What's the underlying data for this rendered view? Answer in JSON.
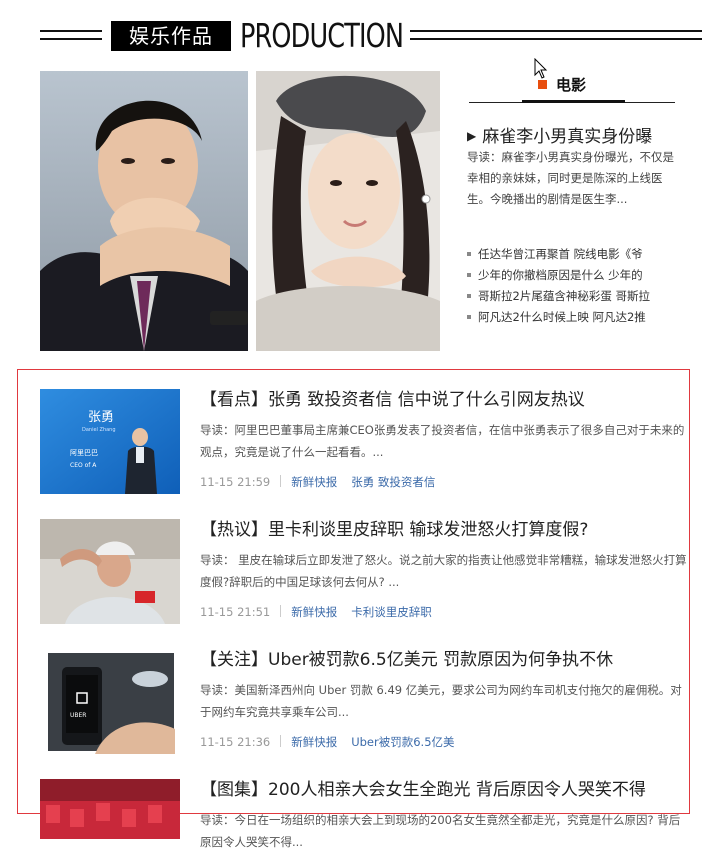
{
  "section": {
    "label_cn": "娱乐作品",
    "label_en": "PRODUCTION"
  },
  "movie_panel": {
    "tab_label": "电影",
    "accent_color": "#e84e0f",
    "featured": {
      "title": "麻雀李小男真实身份曝",
      "intro": "导读：麻雀李小男真实身份曝光，不仅是幸相的亲妹妹，同时更是陈深的上线医生。今晚播出的剧情是医生李..."
    },
    "list": [
      "任达华曾江再聚首 院线电影《爷",
      "少年的你撤档原因是什么 少年的",
      "哥斯拉2片尾蕴含神秘彩蛋 哥斯拉",
      "阿凡达2什么时候上映 阿凡达2推"
    ]
  },
  "news": [
    {
      "title": "【看点】张勇 致投资者信 信中说了什么引网友热议",
      "desc": "导读：阿里巴巴董事局主席兼CEO张勇发表了投资者信，在信中张勇表示了很多自己对于未来的观点，究竟是说了什么一起看看。...",
      "time": "11-15 21:59",
      "category": "新鲜快报",
      "tag": "张勇 致投资者信",
      "thumb_name": "张勇",
      "thumb_sub": "Daniel Zhang",
      "thumb_org": "阿里巴巴",
      "thumb_role": "CEO of A"
    },
    {
      "title": "【热议】里卡利谈里皮辞职 输球发泄怒火打算度假?",
      "desc": "导读： 里皮在输球后立即发泄了怒火。说之前大家的指责让他感觉非常糟糕，输球发泄怒火打算度假?辞职后的中国足球该何去何从? ...",
      "time": "11-15 21:51",
      "category": "新鲜快报",
      "tag": "卡利谈里皮辞职"
    },
    {
      "title": "【关注】Uber被罚款6.5亿美元 罚款原因为何争执不休",
      "desc": "导读：美国新泽西州向 Uber 罚款 6.49 亿美元，要求公司为网约车司机支付拖欠的雇佣税。对于网约车究竟共享乘车公司...",
      "time": "11-15 21:36",
      "category": "新鲜快报",
      "tag": "Uber被罚款6.5亿美",
      "thumb_brand": "UBER"
    },
    {
      "title": "【图集】200人相亲大会女生全跑光 背后原因令人哭笑不得",
      "desc": "导读：今日在一场组织的相亲大会上到现场的200名女生竟然全都走光，究竟是什么原因? 背后原因令人哭笑不得..."
    }
  ]
}
